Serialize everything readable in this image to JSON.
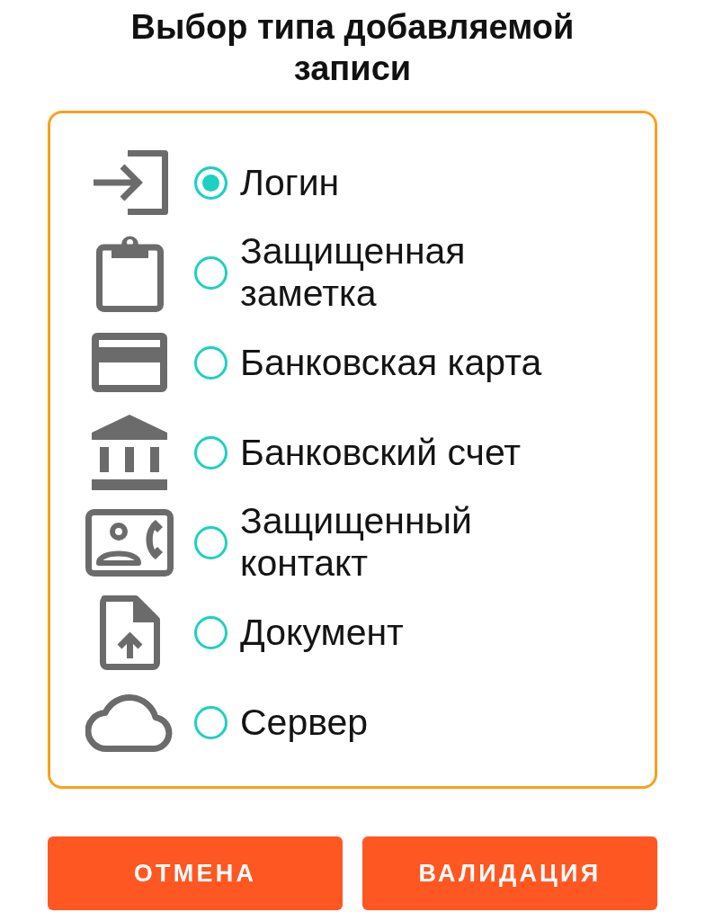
{
  "title": "Выбор типа добавляемой записи",
  "options": [
    {
      "kind": "login",
      "label": "Логин",
      "selected": true
    },
    {
      "kind": "note",
      "label": "Защищенная заметка",
      "selected": false
    },
    {
      "kind": "card",
      "label": "Банковская карта",
      "selected": false
    },
    {
      "kind": "bank",
      "label": "Банковский счет",
      "selected": false
    },
    {
      "kind": "contact",
      "label": "Защищенный контакт",
      "selected": false
    },
    {
      "kind": "document",
      "label": "Документ",
      "selected": false
    },
    {
      "kind": "server",
      "label": "Сервер",
      "selected": false
    }
  ],
  "buttons": [
    {
      "label": "ОТМЕНА"
    },
    {
      "label": "ВАЛИДАЦИЯ"
    }
  ]
}
